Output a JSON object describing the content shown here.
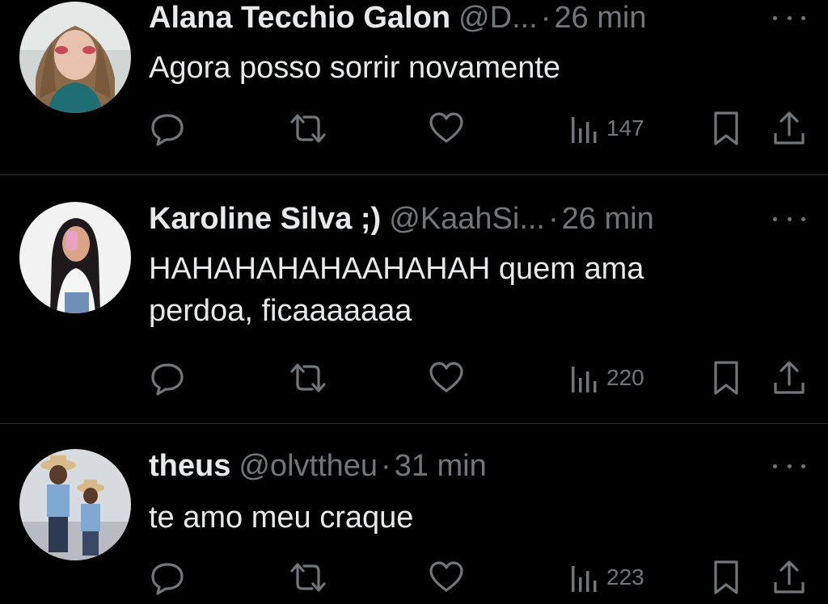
{
  "tweets": [
    {
      "name": "Alana Tecchio Galon",
      "handle": "@D...",
      "dot": "·",
      "time": "26 min",
      "text": "Agora posso sorrir novamente",
      "views": "147"
    },
    {
      "name": "Karoline Silva ;)",
      "handle": "@KaahSi...",
      "dot": "·",
      "time": "26 min",
      "text": "HAHAHAHAHAAHAHAH quem ama\nperdoa, ficaaaaaaa",
      "views": "220"
    },
    {
      "name": "theus",
      "handle": "@olvttheu",
      "dot": "·",
      "time": "31 min",
      "text": "te amo meu craque",
      "views": "223"
    }
  ],
  "icons": {
    "reply": "reply-icon",
    "retweet": "retweet-icon",
    "like": "heart-icon",
    "views": "views-bar-chart-icon",
    "bookmark": "bookmark-icon",
    "share": "share-icon",
    "more": "more-dots-icon"
  },
  "colors": {
    "background": "#000000",
    "primary_text": "#e7e9ea",
    "secondary_text": "#71767b",
    "divider": "#2f3336"
  }
}
